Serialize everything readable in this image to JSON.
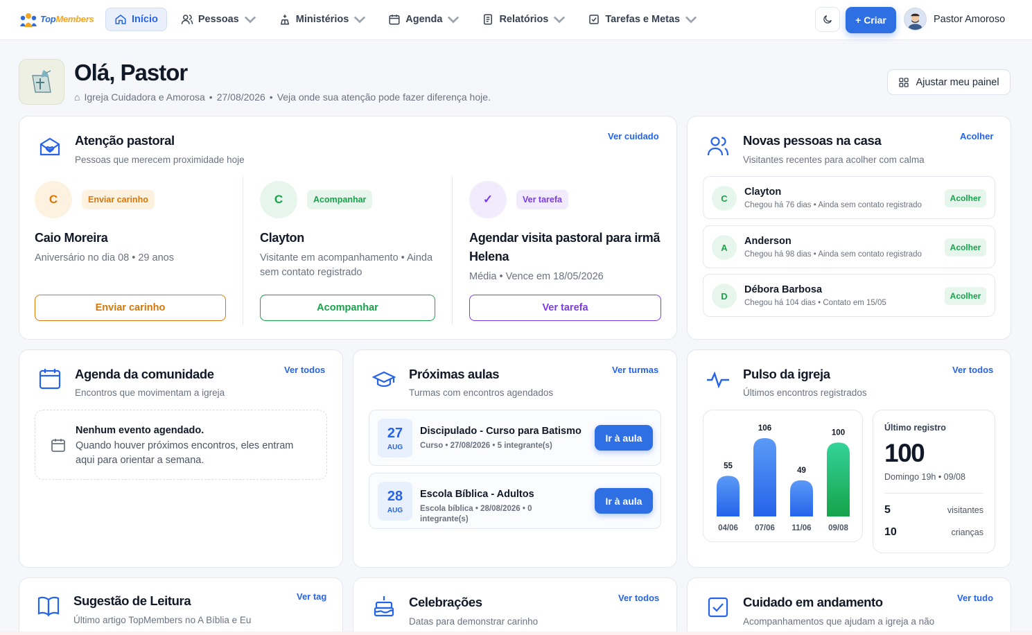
{
  "brand": {
    "name_part1": "Top",
    "name_part2": "Members"
  },
  "nav": {
    "items": [
      {
        "label": "Início",
        "icon": "home-icon",
        "active": true
      },
      {
        "label": "Pessoas",
        "icon": "users-icon"
      },
      {
        "label": "Ministérios",
        "icon": "ministry-icon"
      },
      {
        "label": "Agenda",
        "icon": "calendar-icon"
      },
      {
        "label": "Relatórios",
        "icon": "report-icon"
      },
      {
        "label": "Tarefas e Metas",
        "icon": "checkbox-icon"
      }
    ],
    "create_label": "+ Criar",
    "user_name": "Pastor Amoroso"
  },
  "hero": {
    "title": "Olá, Pastor",
    "church": "Igreja Cuidadora e Amorosa",
    "date": "27/08/2026",
    "message": "Veja onde sua atenção pode fazer diferença hoje.",
    "sep": "•",
    "adjust_label": "Ajustar meu painel"
  },
  "attention": {
    "title": "Atenção pastoral",
    "subtitle": "Pessoas que merecem proximidade hoje",
    "link": "Ver cuidado",
    "items": [
      {
        "initial": "C",
        "pill": "Enviar carinho",
        "name": "Caio Moreira",
        "desc": "Aniversário no dia 08 • 29 anos",
        "button": "Enviar carinho",
        "color": "#d97706"
      },
      {
        "initial": "C",
        "pill": "Acompanhar",
        "name": "Clayton",
        "desc": "Visitante em acompanhamento • Ainda sem contato registrado",
        "button": "Acompanhar",
        "color": "#16a34a"
      },
      {
        "initial": "✓",
        "pill": "Ver tarefa",
        "name": "Agendar visita pastoral para irmã Helena",
        "desc": "Média • Vence em 18/05/2026",
        "button": "Ver tarefa",
        "color": "#7c3aed"
      }
    ]
  },
  "new_people": {
    "title": "Novas pessoas na casa",
    "subtitle": "Visitantes recentes para acolher com calma",
    "link": "Acolher",
    "items": [
      {
        "initial": "C",
        "name": "Clayton",
        "desc": "Chegou há 76 dias • Ainda sem contato registrado",
        "button": "Acolher"
      },
      {
        "initial": "A",
        "name": "Anderson",
        "desc": "Chegou há 98 dias • Ainda sem contato registrado",
        "button": "Acolher"
      },
      {
        "initial": "D",
        "name": "Débora Barbosa",
        "desc": "Chegou há 104 dias • Contato em 15/05",
        "button": "Acolher"
      }
    ]
  },
  "agenda": {
    "title": "Agenda da comunidade",
    "subtitle": "Encontros que movimentam a igreja",
    "link": "Ver todos",
    "empty_title": "Nenhum evento agendado.",
    "empty_text": "Quando houver próximos encontros, eles entram aqui para orientar a semana."
  },
  "classes": {
    "title": "Próximas aulas",
    "subtitle": "Turmas com encontros agendados",
    "link": "Ver turmas",
    "items": [
      {
        "day": "27",
        "month": "AUG",
        "name": "Discipulado - Curso para Batismo",
        "meta": "Curso • 27/08/2026 • 5 integrante(s)",
        "button": "Ir à aula"
      },
      {
        "day": "28",
        "month": "AUG",
        "name": "Escola Bíblica - Adultos",
        "meta": "Escola bíblica • 28/08/2026 • 0 integrante(s)",
        "button": "Ir à aula"
      }
    ]
  },
  "pulse": {
    "title": "Pulso da igreja",
    "subtitle": "Últimos encontros registrados",
    "link": "Ver todos",
    "last_label": "Último registro",
    "last_value": "100",
    "last_when": "Domingo 19h • 09/08",
    "visitors_value": "5",
    "visitors_label": "visitantes",
    "children_value": "10",
    "children_label": "crianças"
  },
  "chart_data": {
    "type": "bar",
    "categories": [
      "04/06",
      "07/06",
      "11/06",
      "09/08"
    ],
    "values": [
      55,
      106,
      49,
      100
    ],
    "ylim": [
      0,
      106
    ],
    "colors": [
      "#2f6fe4",
      "#2f6fe4",
      "#2f6fe4",
      "#16a34a"
    ]
  },
  "reading": {
    "title": "Sugestão de Leitura",
    "subtitle": "Último artigo TopMembers no A Bíblia e Eu",
    "link": "Ver tag"
  },
  "celebrations": {
    "title": "Celebrações",
    "subtitle": "Datas para demonstrar carinho",
    "link": "Ver todos"
  },
  "care": {
    "title": "Cuidado em andamento",
    "subtitle": "Acompanhamentos que ajudam a igreja a não",
    "link": "Ver tudo"
  }
}
